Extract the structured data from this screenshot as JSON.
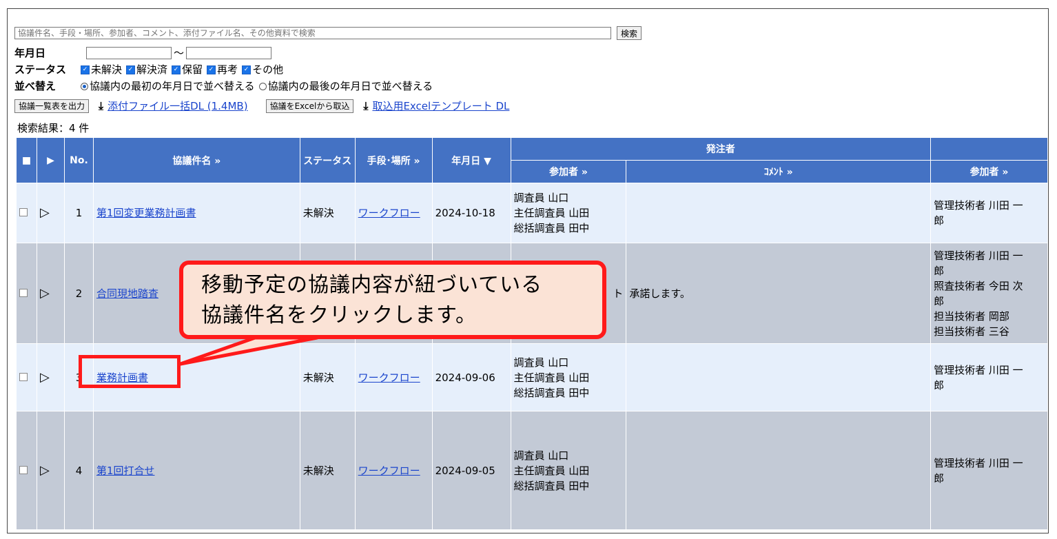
{
  "search": {
    "placeholder": "協議件名、手段・場所、参加者、コメント、添付ファイル名、その他資料で検索",
    "button": "検索"
  },
  "date_filter": {
    "label": "年月日",
    "separator": "～"
  },
  "status_filter": {
    "label": "ステータス",
    "options": [
      "未解決",
      "解決済",
      "保留",
      "再考",
      "その他"
    ]
  },
  "sort": {
    "label": "並べ替え",
    "options": [
      "協議内の最初の年月日で並べ替える",
      "協議内の最後の年月日で並べ替える"
    ]
  },
  "actions": {
    "export_button": "協議一覧表を出力",
    "attach_dl": "添付ファイル一括DL (1.4MB)",
    "import_button": "協議をExcelから取込",
    "template_dl": "取込用Excelテンプレート DL"
  },
  "result_count": "検索結果：4 件",
  "table": {
    "headers": {
      "no": "No.",
      "title": "協議件名 »",
      "status": "ステータス",
      "means": "手段･場所 »",
      "date": "年月日 ▼",
      "orderer": "発注者",
      "participants": "参加者 »",
      "comment": "ｺﾒﾝﾄ »",
      "participants2": "参加者 »"
    },
    "rows": [
      {
        "no": "1",
        "title": "第1回変更業務計画書",
        "status": "未解決",
        "means": "ワークフロー",
        "date": "2024-10-18",
        "participants": [
          "調査員 山口",
          "主任調査員 山田",
          "総括調査員 田中"
        ],
        "comment": "",
        "participants2": [
          "管理技術者 川田 一",
          "郎"
        ]
      },
      {
        "no": "2",
        "title": "合同現地踏査",
        "status": "",
        "means": "",
        "date": "",
        "participants": [
          "",
          "ト",
          ""
        ],
        "comment": "承諾します。",
        "participants2": [
          "管理技術者 川田 一",
          "郎",
          "照査技術者 今田 次",
          "郎",
          "担当技術者 岡部",
          "担当技術者 三谷"
        ]
      },
      {
        "no": "3",
        "title": "業務計画書",
        "status": "未解決",
        "means": "ワークフロー",
        "date": "2024-09-06",
        "participants": [
          "調査員 山口",
          "主任調査員 山田",
          "総括調査員 田中"
        ],
        "comment": "",
        "participants2": [
          "管理技術者 川田 一",
          "郎"
        ]
      },
      {
        "no": "4",
        "title": "第1回打合せ",
        "status": "未解決",
        "means": "ワークフロー",
        "date": "2024-09-05",
        "participants": [
          "調査員 山口",
          "主任調査員 山田",
          "総括調査員 田中"
        ],
        "comment": "",
        "participants2": [
          "管理技術者 川田 一",
          "郎"
        ]
      }
    ]
  },
  "callout": {
    "line1": "移動予定の協議内容が紐づいている",
    "line2": "協議件名をクリックします。"
  }
}
